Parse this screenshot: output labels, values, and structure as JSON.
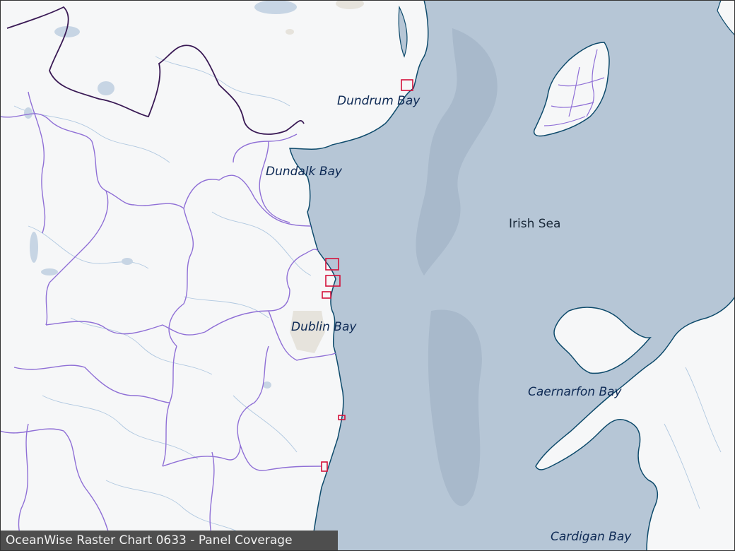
{
  "caption": "OceanWise Raster Chart 0633 - Panel Coverage",
  "place_labels": {
    "dundrum_bay": "Dundrum Bay",
    "dundalk_bay": "Dundalk Bay",
    "irish_sea": "Irish Sea",
    "dublin_bay": "Dublin Bay",
    "caernarfon_bay": "Caernarfon Bay",
    "cardigan_bay": "Cardigan Bay"
  },
  "colors": {
    "sea": "#b6c6d6",
    "land": "#f6f7f8",
    "coastline": "#0d4a6b",
    "county_border": "#8f6fd6",
    "national_border": "#3a1a55",
    "panel_box": "#d4113a",
    "bank": "#a8b9cb"
  }
}
